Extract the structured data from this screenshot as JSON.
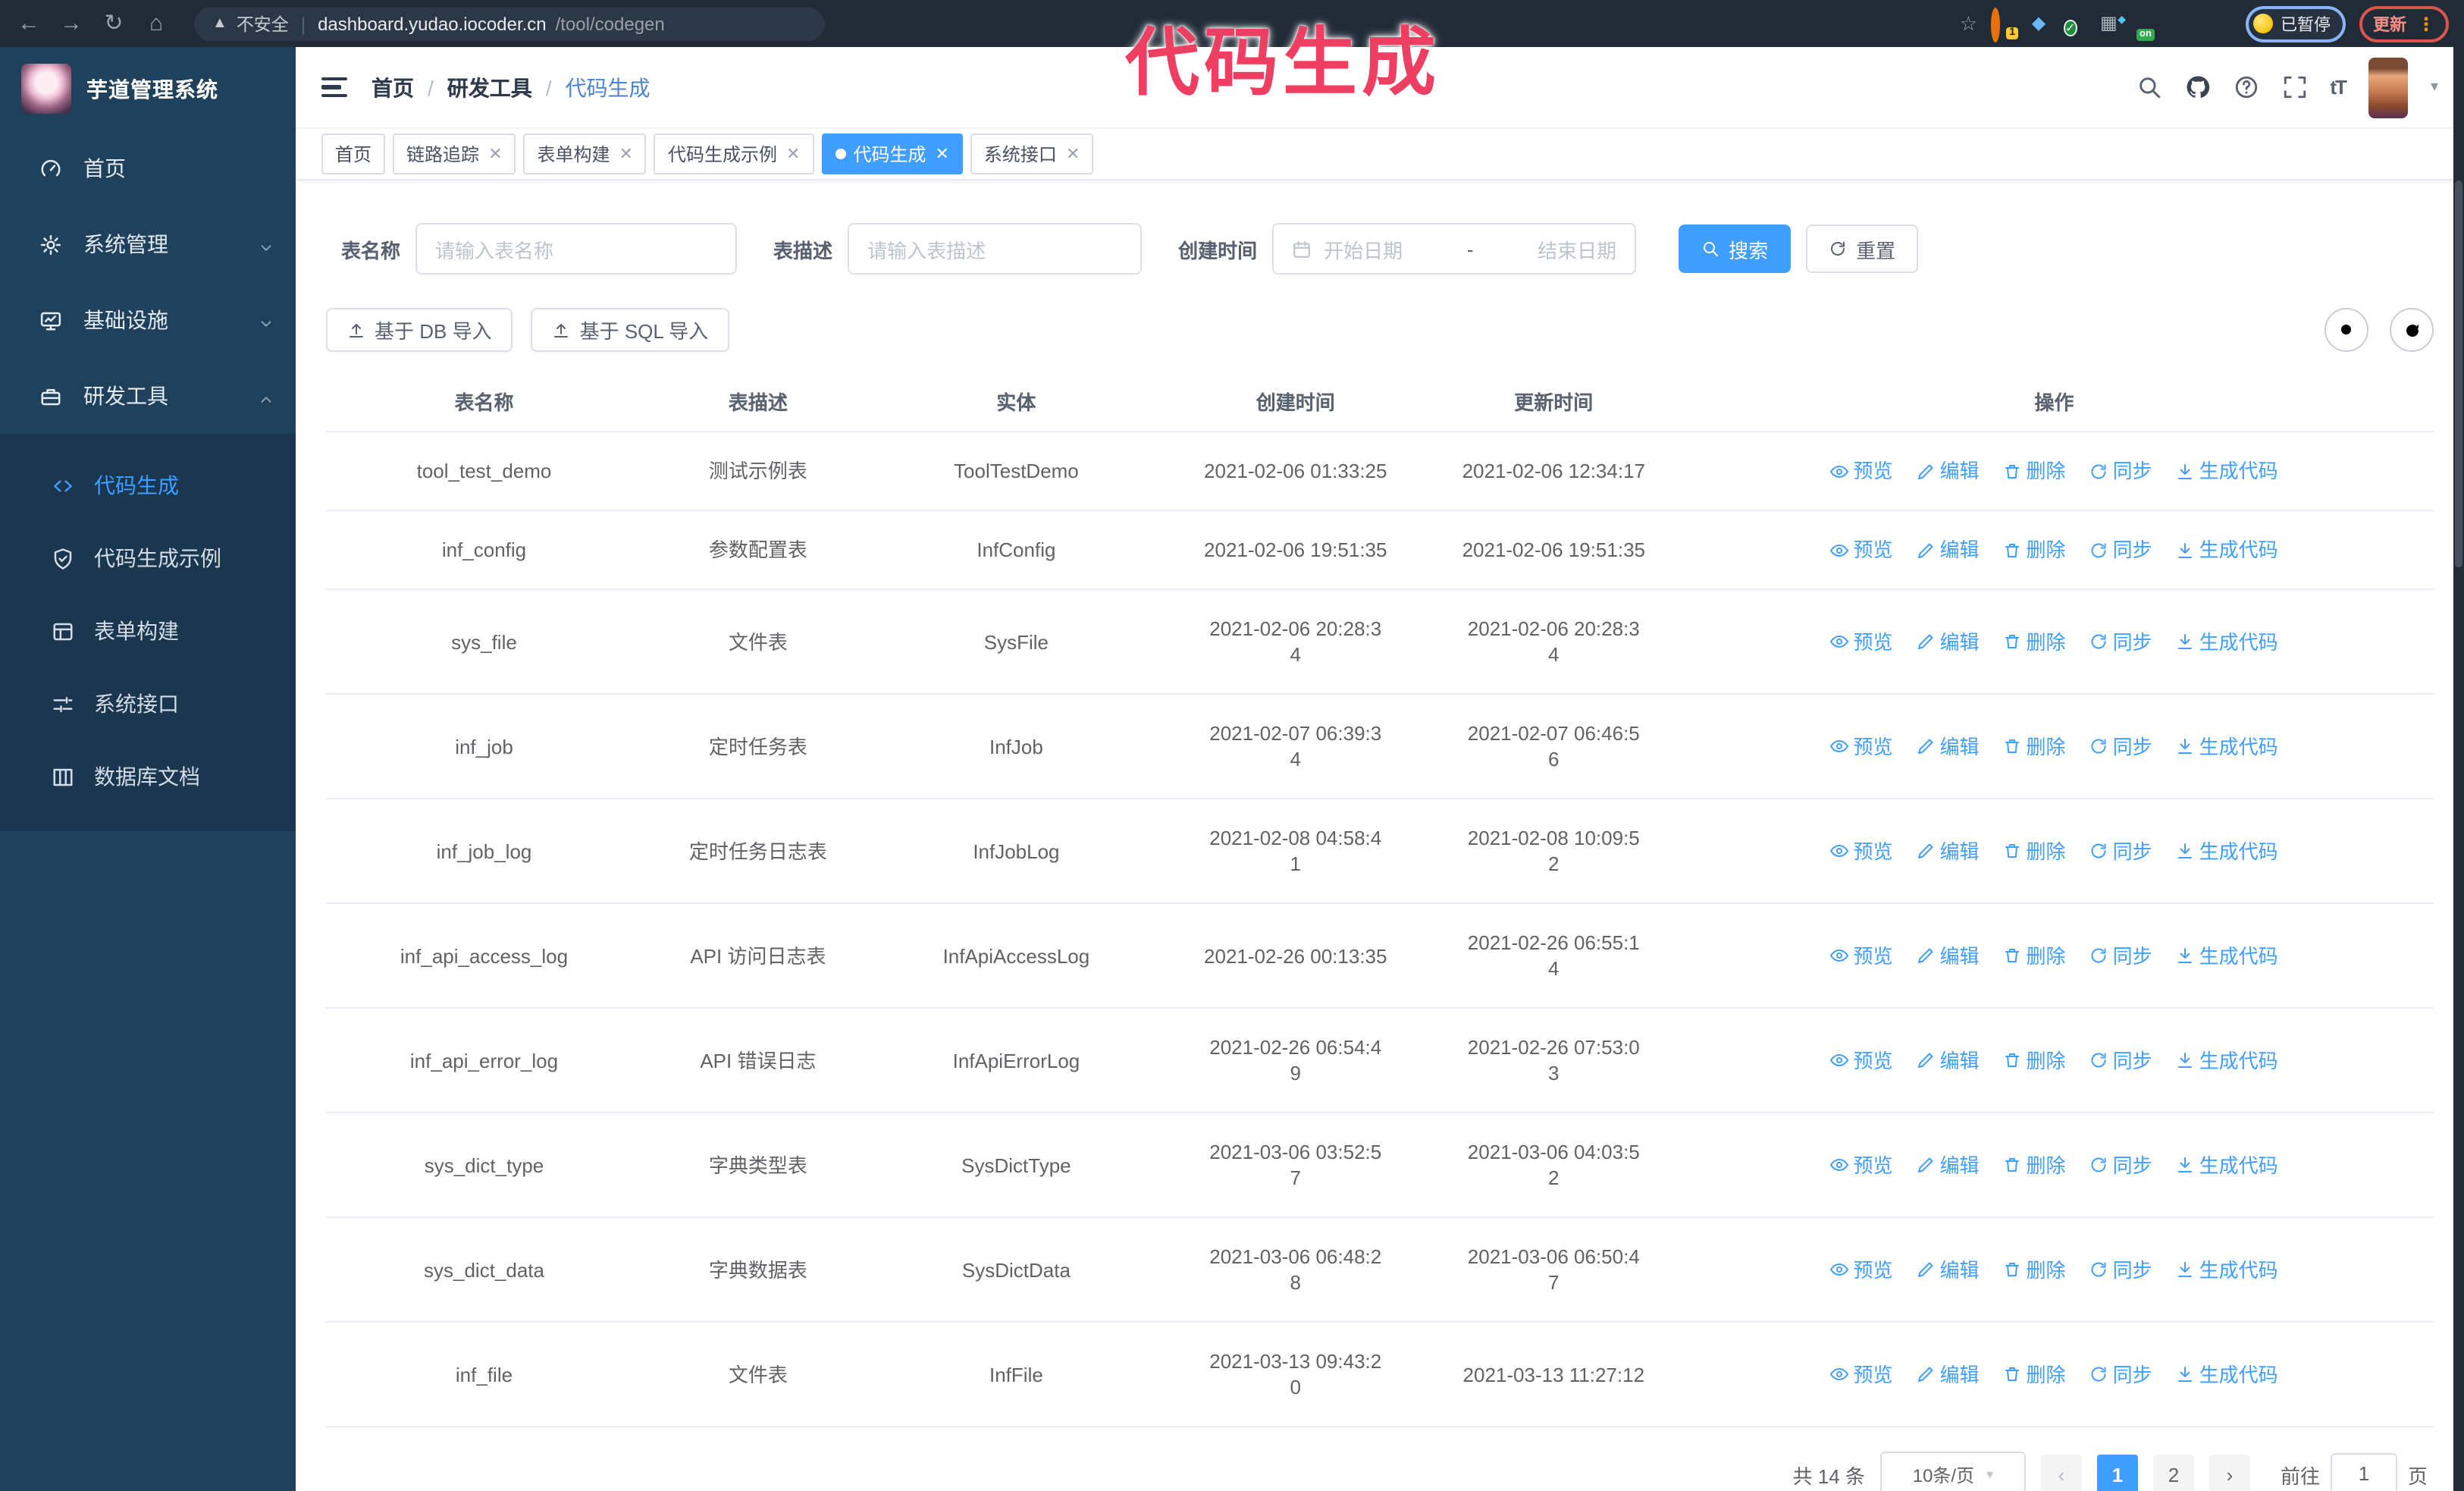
{
  "annotation": {
    "text": "代码生成"
  },
  "browser": {
    "security_text": "不安全",
    "url_host": "dashboard.yudao.iocoder.cn",
    "url_path": "/tool/codegen",
    "ext_badge": "1",
    "ext_on_badge": "on",
    "profile_chip": "已暂停",
    "update_button": "更新"
  },
  "sidebar": {
    "logo_title": "芋道管理系统",
    "items": [
      {
        "label": "首页"
      },
      {
        "label": "系统管理"
      },
      {
        "label": "基础设施"
      },
      {
        "label": "研发工具"
      }
    ],
    "sub_items": [
      {
        "label": "代码生成"
      },
      {
        "label": "代码生成示例"
      },
      {
        "label": "表单构建"
      },
      {
        "label": "系统接口"
      },
      {
        "label": "数据库文档"
      }
    ]
  },
  "navbar": {
    "breadcrumb": [
      "首页",
      "研发工具",
      "代码生成"
    ]
  },
  "tags": [
    {
      "label": "首页"
    },
    {
      "label": "链路追踪"
    },
    {
      "label": "表单构建"
    },
    {
      "label": "代码生成示例"
    },
    {
      "label": "代码生成"
    },
    {
      "label": "系统接口"
    }
  ],
  "search": {
    "name_label": "表名称",
    "name_placeholder": "请输入表名称",
    "desc_label": "表描述",
    "desc_placeholder": "请输入表描述",
    "time_label": "创建时间",
    "start_placeholder": "开始日期",
    "range_separator": "-",
    "end_placeholder": "结束日期",
    "search_label": "搜索",
    "reset_label": "重置"
  },
  "toolbar": {
    "db_import": "基于 DB 导入",
    "sql_import": "基于 SQL 导入"
  },
  "table": {
    "columns": [
      "表名称",
      "表描述",
      "实体",
      "创建时间",
      "更新时间",
      "操作"
    ],
    "actions": {
      "preview": "预览",
      "edit": "编辑",
      "delete": "删除",
      "sync": "同步",
      "generate": "生成代码"
    },
    "rows": [
      {
        "name": "tool_test_demo",
        "desc": "测试示例表",
        "entity": "ToolTestDemo",
        "created": "2021-02-06 01:33:25",
        "updated": "2021-02-06 12:34:17"
      },
      {
        "name": "inf_config",
        "desc": "参数配置表",
        "entity": "InfConfig",
        "created": "2021-02-06 19:51:35",
        "updated": "2021-02-06 19:51:35"
      },
      {
        "name": "sys_file",
        "desc": "文件表",
        "entity": "SysFile",
        "created": "2021-02-06 20:28:3\n4",
        "updated": "2021-02-06 20:28:3\n4"
      },
      {
        "name": "inf_job",
        "desc": "定时任务表",
        "entity": "InfJob",
        "created": "2021-02-07 06:39:3\n4",
        "updated": "2021-02-07 06:46:5\n6"
      },
      {
        "name": "inf_job_log",
        "desc": "定时任务日志表",
        "entity": "InfJobLog",
        "created": "2021-02-08 04:58:4\n1",
        "updated": "2021-02-08 10:09:5\n2"
      },
      {
        "name": "inf_api_access_log",
        "desc": "API 访问日志表",
        "entity": "InfApiAccessLog",
        "created": "2021-02-26 00:13:35",
        "updated": "2021-02-26 06:55:1\n4"
      },
      {
        "name": "inf_api_error_log",
        "desc": "API 错误日志",
        "entity": "InfApiErrorLog",
        "created": "2021-02-26 06:54:4\n9",
        "updated": "2021-02-26 07:53:0\n3"
      },
      {
        "name": "sys_dict_type",
        "desc": "字典类型表",
        "entity": "SysDictType",
        "created": "2021-03-06 03:52:5\n7",
        "updated": "2021-03-06 04:03:5\n2"
      },
      {
        "name": "sys_dict_data",
        "desc": "字典数据表",
        "entity": "SysDictData",
        "created": "2021-03-06 06:48:2\n8",
        "updated": "2021-03-06 06:50:4\n7"
      },
      {
        "name": "inf_file",
        "desc": "文件表",
        "entity": "InfFile",
        "created": "2021-03-13 09:43:2\n0",
        "updated": "2021-03-13 11:27:12"
      }
    ]
  },
  "pagination": {
    "total": "共 14 条",
    "page_size": "10条/页",
    "page1": "1",
    "page2": "2",
    "goto_label": "前往",
    "goto_value": "1",
    "page_suffix": "页"
  }
}
